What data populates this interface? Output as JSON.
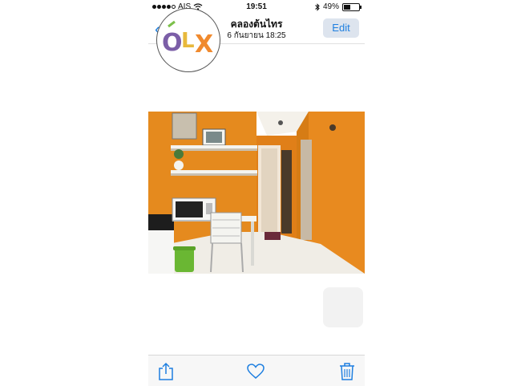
{
  "status_bar": {
    "carrier": "AIS",
    "time": "19:51",
    "battery_percent": "49%",
    "battery_level": 0.49
  },
  "nav": {
    "back_icon": "chevron-left-icon",
    "title": "คลองต้นไทร",
    "subtitle": "6 กันยายน  18:25",
    "edit_label": "Edit"
  },
  "watermark": {
    "text": "OLX",
    "colors": [
      "#7b5ea7",
      "#e8b93c",
      "#7cc04a",
      "#f08a2e"
    ]
  },
  "photo": {
    "subject": "apartment-interior",
    "wall_color": "#e8891c"
  },
  "toolbar": {
    "share_icon": "share-icon",
    "favorite_icon": "heart-icon",
    "delete_icon": "trash-icon",
    "accent": "#1e7fe0"
  }
}
